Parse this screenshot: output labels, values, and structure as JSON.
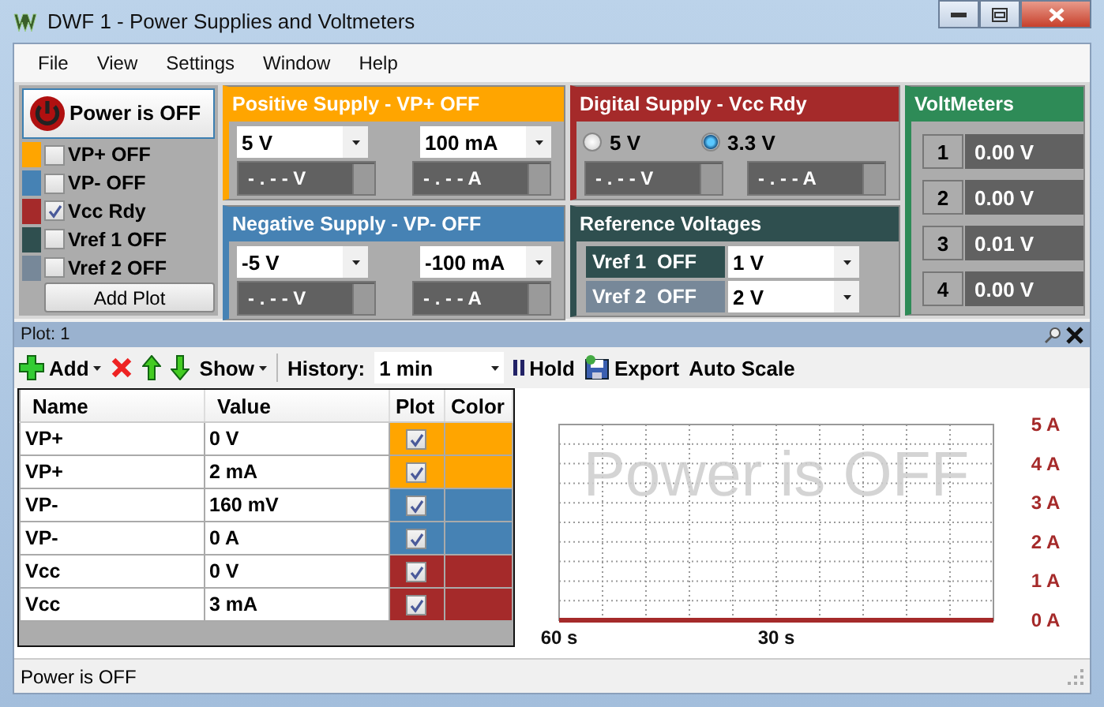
{
  "window": {
    "title": "DWF 1 - Power Supplies and Voltmeters"
  },
  "menu": [
    "File",
    "View",
    "Settings",
    "Window",
    "Help"
  ],
  "power_button": {
    "label": "Power is OFF"
  },
  "channels": [
    {
      "label": "VP+ OFF",
      "color": "#ffa500",
      "checked": false
    },
    {
      "label": "VP-  OFF",
      "color": "#4682b4",
      "checked": false
    },
    {
      "label": "Vcc Rdy",
      "color": "#a52a2a",
      "checked": true
    },
    {
      "label": "Vref 1  OFF",
      "color": "#2f4f4f",
      "checked": false
    },
    {
      "label": "Vref 2  OFF",
      "color": "#778899",
      "checked": false
    }
  ],
  "add_plot_button": "Add Plot",
  "supplies": [
    {
      "title": "Positive Supply - VP+ OFF",
      "color": "#ffa500",
      "voltage": "5 V",
      "current": "100 mA",
      "voltage_reading": "- . - - V",
      "current_reading": "- . - - A"
    },
    {
      "title": "Negative Supply - VP- OFF",
      "color": "#4682b4",
      "voltage": "-5 V",
      "current": "-100 mA",
      "voltage_reading": "- . - - V",
      "current_reading": "- . - - A"
    }
  ],
  "digital_supply": {
    "title": "Digital Supply - Vcc Rdy",
    "options": [
      {
        "label": "5 V",
        "selected": false
      },
      {
        "label": "3.3 V",
        "selected": true
      }
    ],
    "voltage_reading": "- . - - V",
    "current_reading": "- . - - A"
  },
  "reference_voltages": {
    "title": "Reference Voltages",
    "rows": [
      {
        "label": "Vref 1  OFF",
        "color": "#2f4f4f",
        "value": "1 V"
      },
      {
        "label": "Vref 2  OFF",
        "color": "#778899",
        "value": "2 V"
      }
    ]
  },
  "voltmeters": {
    "title": "VoltMeters",
    "meters": [
      {
        "index": "1",
        "reading": "0.00 V"
      },
      {
        "index": "2",
        "reading": "0.00 V"
      },
      {
        "index": "3",
        "reading": "0.01 V"
      },
      {
        "index": "4",
        "reading": "0.00 V"
      }
    ]
  },
  "plot_panel": {
    "title": "Plot: 1",
    "toolbar": {
      "add": "Add",
      "show": "Show",
      "history_label": "History:",
      "history_value": "1 min",
      "hold": "Hold",
      "export": "Export",
      "auto_scale": "Auto Scale"
    },
    "table": {
      "columns": [
        "Name",
        "Value",
        "Plot",
        "Color"
      ],
      "rows": [
        {
          "name": "VP+",
          "value": "0 V",
          "checked": true,
          "color": "#ffa500"
        },
        {
          "name": "VP+",
          "value": "2 mA",
          "checked": true,
          "color": "#ffa500"
        },
        {
          "name": "VP-",
          "value": "160 mV",
          "checked": true,
          "color": "#4682b4"
        },
        {
          "name": "VP-",
          "value": "0 A",
          "checked": true,
          "color": "#4682b4"
        },
        {
          "name": "Vcc",
          "value": "0 V",
          "checked": true,
          "color": "#a52a2a"
        },
        {
          "name": "Vcc",
          "value": "3 mA",
          "checked": true,
          "color": "#a52a2a"
        }
      ]
    },
    "watermark": "Power is OFF",
    "chart_data": {
      "type": "line",
      "grid": true,
      "xticks": [
        {
          "value": 60,
          "label": "60 s"
        },
        {
          "value": 30,
          "label": "30 s"
        }
      ],
      "xlim": [
        60,
        0
      ],
      "ylim": [
        0,
        5
      ],
      "yticks": [
        {
          "value": 5,
          "label": "5 A"
        },
        {
          "value": 4,
          "label": "4 A"
        },
        {
          "value": 3,
          "label": "3 A"
        },
        {
          "value": 2,
          "label": "2 A"
        },
        {
          "value": 1,
          "label": "1 A"
        },
        {
          "value": 0,
          "label": "0 A"
        }
      ]
    }
  },
  "status_bar": "Power is OFF"
}
